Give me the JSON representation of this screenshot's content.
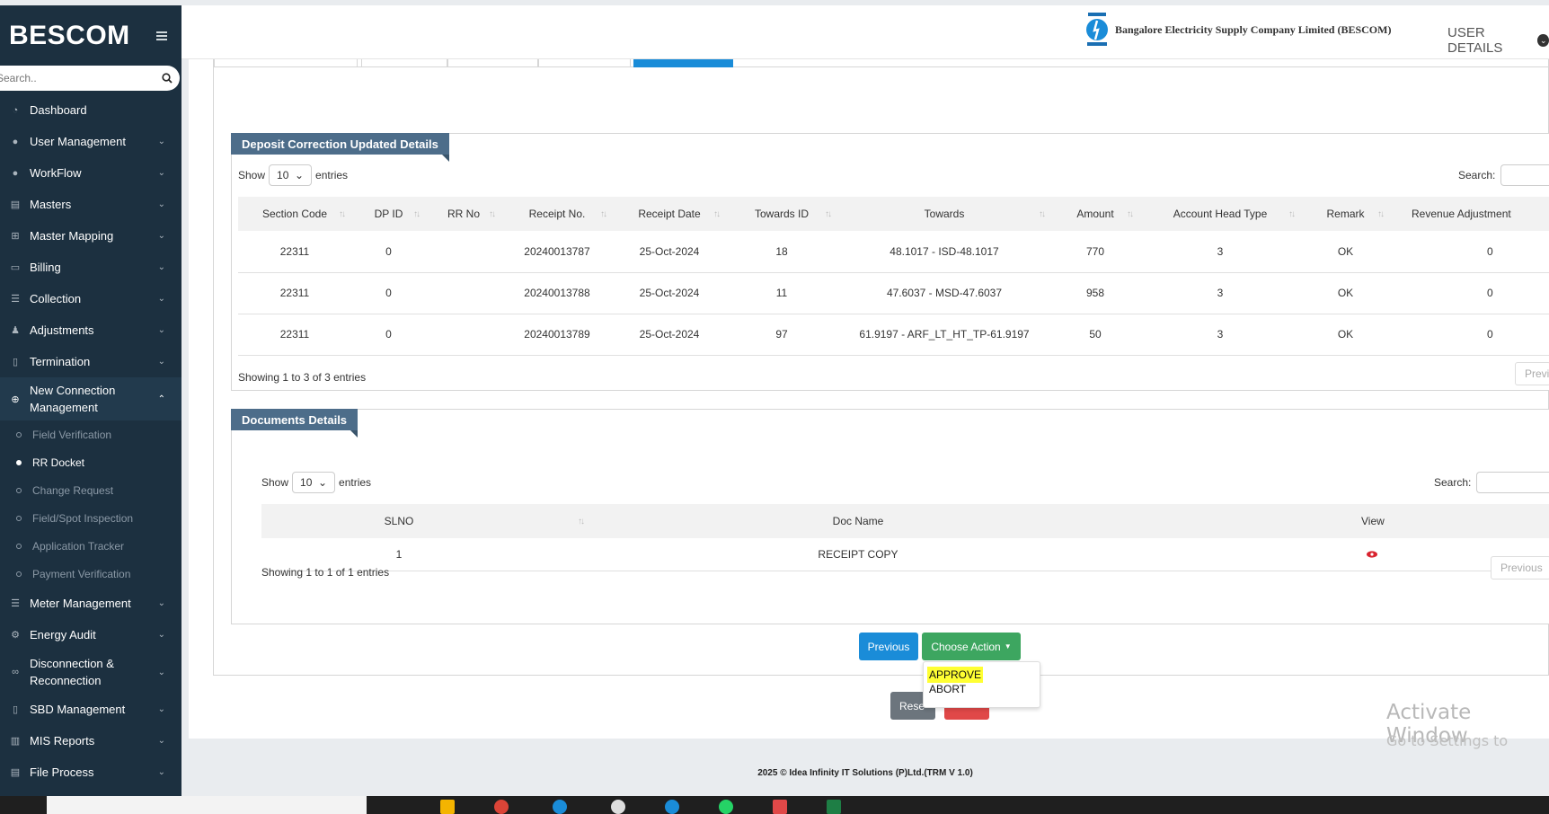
{
  "sidebar": {
    "brand": "BESCOM",
    "search_placeholder": "Search..",
    "items": [
      {
        "label": "Dashboard"
      },
      {
        "label": "User Management"
      },
      {
        "label": "WorkFlow"
      },
      {
        "label": "Masters"
      },
      {
        "label": "Master Mapping"
      },
      {
        "label": "Billing"
      },
      {
        "label": "Collection"
      },
      {
        "label": "Adjustments"
      },
      {
        "label": "Termination"
      },
      {
        "label": "New Connection Management"
      },
      {
        "label": "Meter Management"
      },
      {
        "label": "Energy Audit"
      },
      {
        "label": "Disconnection & Reconnection"
      },
      {
        "label": "SBD Management"
      },
      {
        "label": "MIS Reports"
      },
      {
        "label": "File Process"
      }
    ],
    "subitems": [
      {
        "label": "Field Verification"
      },
      {
        "label": "RR Docket"
      },
      {
        "label": "Change Request"
      },
      {
        "label": "Field/Spot Inspection"
      },
      {
        "label": "Application Tracker"
      },
      {
        "label": "Payment Verification"
      }
    ]
  },
  "header": {
    "company": "Bangalore Electricity Supply Company Limited (BESCOM)",
    "user_details": "USER DETAILS"
  },
  "deposit": {
    "title": "Deposit Correction Updated Details",
    "show": "Show",
    "entries_value": "10",
    "entries": "entries",
    "search_label": "Search:",
    "columns": [
      "Section Code",
      "DP ID",
      "RR No",
      "Receipt No.",
      "Receipt Date",
      "Towards ID",
      "Towards",
      "Amount",
      "Account Head Type",
      "Remark",
      "Revenue Adjustment"
    ],
    "rows": [
      [
        "22311",
        "0",
        "",
        "20240013787",
        "25-Oct-2024",
        "18",
        "48.1017 - ISD-48.1017",
        "770",
        "3",
        "OK",
        "0"
      ],
      [
        "22311",
        "0",
        "",
        "20240013788",
        "25-Oct-2024",
        "11",
        "47.6037 - MSD-47.6037",
        "958",
        "3",
        "OK",
        "0"
      ],
      [
        "22311",
        "0",
        "",
        "20240013789",
        "25-Oct-2024",
        "97",
        "61.9197 - ARF_LT_HT_TP-61.9197",
        "50",
        "3",
        "OK",
        "0"
      ]
    ],
    "info": "Showing 1 to 3 of 3 entries",
    "prev_btn": "Previ"
  },
  "documents": {
    "title": "Documents Details",
    "show": "Show",
    "entries_value": "10",
    "entries": "entries",
    "search_label": "Search:",
    "columns": [
      "SLNO",
      "Doc Name",
      "View"
    ],
    "rows": [
      [
        "1",
        "RECEIPT COPY",
        ""
      ]
    ],
    "info": "Showing 1 to 1 of 1 entries",
    "prev_btn": "Previous"
  },
  "actions": {
    "previous": "Previous",
    "choose_action": "Choose Action",
    "options": [
      "APPROVE",
      "ABORT"
    ],
    "reset": "Rese"
  },
  "watermark": {
    "line1": "Activate Window",
    "line2": "Go to Settings to activa"
  },
  "footer": "2025 © Idea Infinity IT Solutions (P)Ltd.(TRM V 1.0)",
  "colors": {
    "sidebar_bg": "#1c3040",
    "ribbon": "#4d6d8a",
    "primary": "#1a8cd8",
    "success": "#3da660",
    "highlight": "#ffff33"
  }
}
